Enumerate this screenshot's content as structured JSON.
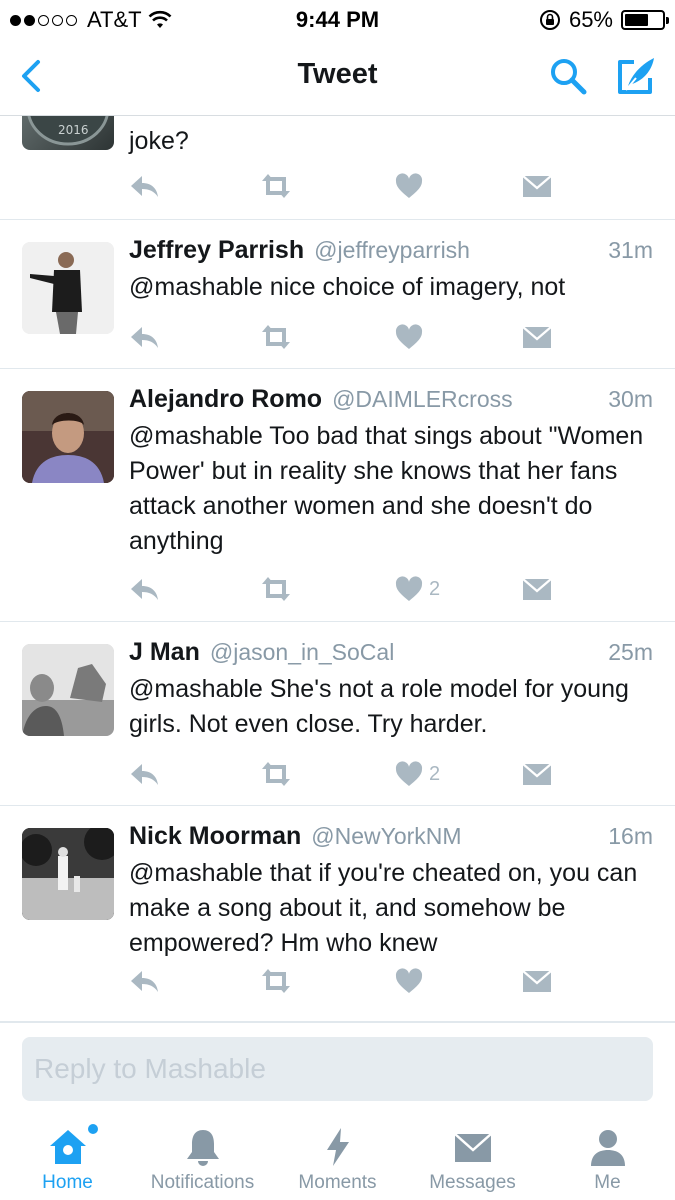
{
  "status_bar": {
    "carrier": "AT&T",
    "time": "9:44 PM",
    "battery": "65%",
    "battery_level": 0.65
  },
  "nav": {
    "title": "Tweet"
  },
  "tweets": [
    {
      "name": "",
      "handle": "",
      "time": "",
      "text": "joke?",
      "likes": "",
      "avatar_label": "2016"
    },
    {
      "name": "Jeffrey Parrish",
      "handle": "@jeffreyparrish",
      "time": "31m",
      "text": "@mashable nice choice of imagery, not",
      "likes": ""
    },
    {
      "name": "Alejandro Romo",
      "handle": "@DAIMLERcross",
      "time": "30m",
      "text": "@mashable Too bad that sings about \"Women Power' but in reality she knows that her fans attack another women and she doesn't do anything",
      "likes": "2"
    },
    {
      "name": "J Man",
      "handle": "@jason_in_SoCal",
      "time": "25m",
      "text": "@mashable She's not a role model for young girls. Not even close. Try harder.",
      "likes": "2"
    },
    {
      "name": "Nick Moorman",
      "handle": "@NewYorkNM",
      "time": "16m",
      "text": "@mashable that if you're cheated on, you can make a song about it, and somehow be empowered? Hm who knew",
      "likes": ""
    }
  ],
  "reply": {
    "placeholder": "Reply to Mashable"
  },
  "tabs": [
    {
      "label": "Home",
      "icon": "home-icon"
    },
    {
      "label": "Notifications",
      "icon": "bell-icon"
    },
    {
      "label": "Moments",
      "icon": "lightning-icon"
    },
    {
      "label": "Messages",
      "icon": "envelope-icon"
    },
    {
      "label": "Me",
      "icon": "person-icon"
    }
  ],
  "colors": {
    "accent": "#1da1f2",
    "icon_gray": "#aab8c2",
    "secondary_text": "#8899a6"
  }
}
